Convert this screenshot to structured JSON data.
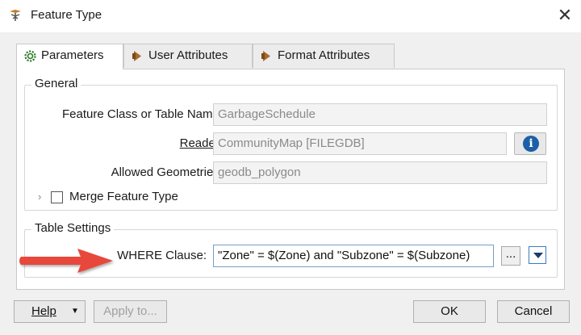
{
  "window": {
    "title": "Feature Type",
    "close_glyph": "✕"
  },
  "tabs": [
    {
      "label": "Parameters",
      "icon": "gear-icon",
      "active": true
    },
    {
      "label": "User Attributes",
      "icon": "attribute-arrow-icon",
      "active": false
    },
    {
      "label": "Format Attributes",
      "icon": "attribute-arrow-icon",
      "active": false
    }
  ],
  "general": {
    "title": "General",
    "feature_class_label": "Feature Class or Table Name:",
    "feature_class_value": "GarbageSchedule",
    "reader_label": "Reader:",
    "reader_value": "CommunityMap [FILEGDB]",
    "info_glyph": "i",
    "allowed_geometries_label": "Allowed Geometries:",
    "allowed_geometries_value": "geodb_polygon",
    "merge_label": "Merge Feature Type",
    "merge_checked": false,
    "expand_glyph": "›"
  },
  "table_settings": {
    "title": "Table Settings",
    "where_label": "WHERE Clause:",
    "where_value": "\"Zone\" = $(Zone) and \"Subzone\" = $(Subzone)",
    "ellipsis_label": "..."
  },
  "footer": {
    "help_label": "Help",
    "help_dropdown_glyph": "▼",
    "apply_label": "Apply to...",
    "ok_label": "OK",
    "cancel_label": "Cancel"
  },
  "colors": {
    "annotation_arrow": "#e8473a",
    "info_blue": "#1c5fa8"
  }
}
